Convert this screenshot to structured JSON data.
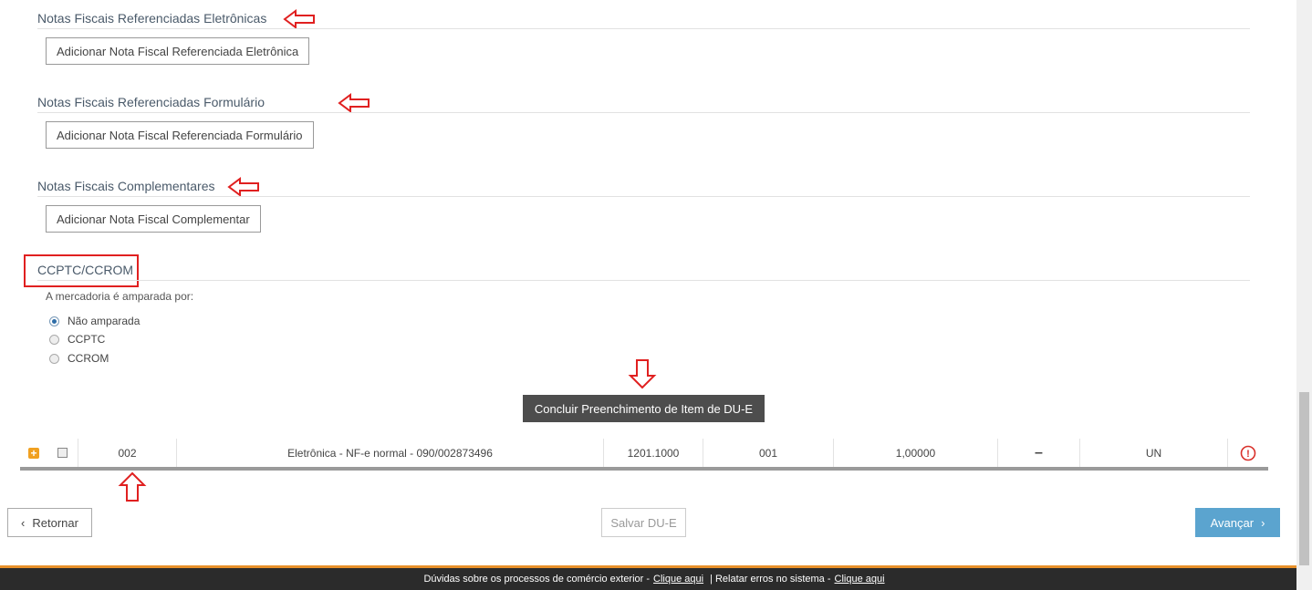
{
  "sections": {
    "electronic": {
      "title": "Notas Fiscais Referenciadas Eletrônicas",
      "button": "Adicionar Nota Fiscal Referenciada Eletrônica"
    },
    "form": {
      "title": "Notas Fiscais Referenciadas Formulário",
      "button": "Adicionar Nota Fiscal Referenciada Formulário"
    },
    "complementary": {
      "title": "Notas Fiscais Complementares",
      "button": "Adicionar Nota Fiscal Complementar"
    },
    "ccptc": {
      "title": "CCPTC/CCROM",
      "question": "A mercadoria é amparada por:",
      "options": [
        "Não amparada",
        "CCPTC",
        "CCROM"
      ],
      "selected": "Não amparada"
    }
  },
  "conclude_button": "Concluir Preenchimento de Item de DU-E",
  "item_row": {
    "item": "002",
    "nota": "Eletrônica - NF-e normal - 090/002873496",
    "ncm": "1201.1000",
    "code": "001",
    "quantity": "1,00000",
    "dash": "–",
    "unit": "UN",
    "warning_icon": "!"
  },
  "nav": {
    "back": "Retornar",
    "save": "Salvar DU-E",
    "next": "Avançar",
    "back_icon": "‹",
    "next_icon": "›"
  },
  "footer": {
    "text1": "Dúvidas sobre os processos de comércio exterior -",
    "link1": "Clique aqui",
    "sep": "|",
    "text2": "Relatar erros no sistema -",
    "link2": "Clique aqui"
  },
  "colors": {
    "annotation": "#e02020",
    "primary": "#5ba4cf",
    "footer_accent": "#e8902a"
  }
}
